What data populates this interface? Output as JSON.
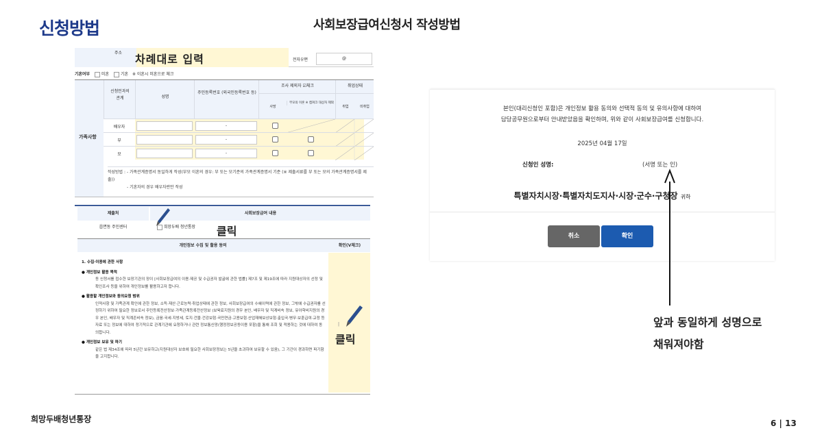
{
  "header": {
    "section": "신청방법",
    "title": "사회보장급여신청서 작성방법"
  },
  "form1": {
    "address_label": "주소",
    "address_overlay": "차례대로 입력",
    "email_label": "전자우편",
    "email_value": "@",
    "marital_label": "기혼여부",
    "marital_opt1": "미혼",
    "marital_opt2": "기혼",
    "marital_note": "※ 이혼시 미혼으로 체크",
    "family_label": "가족사항",
    "col_relation": "신청인과의 관계",
    "col_name": "성명",
    "col_rrn": "주민등록번호 (외국인등록번호 등)",
    "col_exclude": "조사 제외자 ☑체크",
    "col_death": "사망",
    "col_parents": "부모의 이혼 ※ 캡쳐크 대상자 제외",
    "col_job": "취업상태",
    "col_employed": "취업",
    "col_unemployed": "미취업",
    "rows": [
      {
        "relation": "배우자",
        "rrn": "-"
      },
      {
        "relation": "부",
        "rrn": "-"
      },
      {
        "relation": "모",
        "rrn": "-"
      }
    ],
    "note_label": "작성방법 :",
    "note1": "- 가족관계증명서 동일하게 작성(부모 이혼의 경우: 부 또는 모기준의 가족관계증명서 기준 (※ 제출서류를 부 또는 모의 가족관계증명서를 제출))",
    "note2": "- 기혼자의 경우 배우자란만 작성"
  },
  "form2": {
    "col_submitter": "제출처",
    "col_content": "사회보장급여 내용",
    "submitter": "읍면동 주민센터",
    "content": "희망두배 청년통장",
    "click": "클릭",
    "agree_title": "개인정보 수집 및 활용 동의",
    "confirm_title": "확인(V체크)",
    "section1": "1. 수집·이용에 관한 사항",
    "b1_title": "● 개인정보 활용 목적",
    "b1_text": "동 신청서를 접수한 보장기관의 장이 [사회보장급여의 이용·제공 및 수급권자 발굴에 관한 법률] 제7조 및 제19조에 따라 지원대상자의 선정 및 확인조사 등을 위하여 개인정보를 활용하고자 합니다.",
    "b2_title": "● 활용할 개인정보와 동의요청 범위",
    "b2_text": "인적사항 및 가족관계 확인에 관한 정보, 소득·재산·근로능력·취업상태에 관한 정보, 사회보장급여의 수혜이력에 관한 정보, 그밖에 수급권자를 선정하기 위하여 필요한 정보로서 주민등록전산정보·가족관계등록전산정보 (보육료지원의 경우 본인, 배우자 및 직계비속 정보, 유아학비지원의 경우 본인, 배우자 및 직계존비속 정보), 금융·국세·지방세, 토지·건물·건강보험·국민연금·고용보험·산업재해보상보험·출입국·병무·보훈급여·교정 등 자료 또는 정보에 대하여 정기적으로 관계기관에 요청하거나 관련 정보통신망(행정정보공동이용 포함)을 통해 조회 및 적용하는 것에 대하여 동의합니다.",
    "b3_title": "● 개인정보 보유 및 파기",
    "b3_text": "같은 법 제34조에 따라 5년간 보유하고(지원대상자 보호에 필요한 사회보장정보는 5년을 초과하여 보유할 수 있음), 그 기간이 경과하면 파기함을 고지합니다."
  },
  "dialog": {
    "message_line1": "본인(대리신청인 포함)은 개인정보 활용 동의와 선택적 동의 및 유의사항에 대하여",
    "message_line2": "담당공무원으로부터 안내받았음을 확인하며, 위와 같이 사회보장급여를 신청합니다.",
    "date": "2025년 04월 17일",
    "sig_label": "신청인 성명:",
    "sig_value": "(서명 또는 인)",
    "addressee": "특별자치시장·특별자치도지사·시장·군수·구청장",
    "addressee_suffix": "귀하",
    "cancel": "취소",
    "ok": "확인",
    "ok_color": "#1c5bb0"
  },
  "annotation": {
    "line1": "앞과 동일하게 성명으로",
    "line2": "채워져야함"
  },
  "footer": {
    "left": "희망두배청년통장",
    "page": "6 | 13"
  }
}
